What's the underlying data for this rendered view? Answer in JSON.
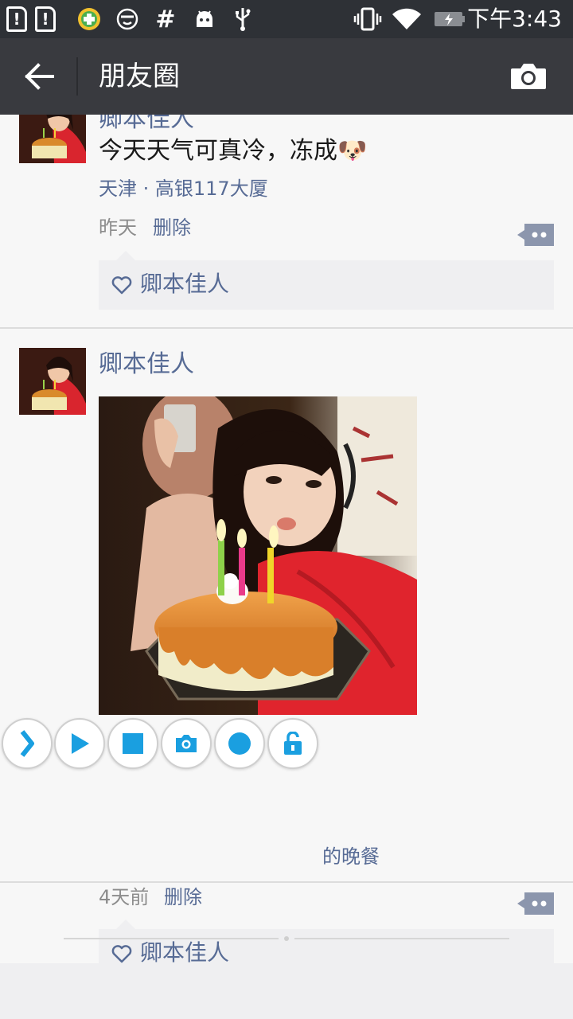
{
  "status_bar": {
    "time": "下午3:43",
    "icons": [
      "sim-alert-icon",
      "sim-alert-icon",
      "security-app-icon",
      "face-icon",
      "hash-icon",
      "android-debug-icon",
      "usb-icon",
      "vibrate-icon",
      "wifi-icon",
      "battery-charging-icon"
    ]
  },
  "header": {
    "title": "朋友圈",
    "back_icon": "arrow-left-icon",
    "camera_icon": "camera-icon"
  },
  "posts": [
    {
      "author": "卿本佳人",
      "text": "今天天气可真冷，冻成🐶",
      "location": "天津 · 高银117大厦",
      "time": "昨天",
      "delete_label": "删除",
      "likes": [
        "卿本佳人"
      ]
    },
    {
      "author": "卿本佳人",
      "caption_visible": "的晚餐",
      "time": "4天前",
      "delete_label": "删除",
      "likes": [
        "卿本佳人"
      ]
    }
  ],
  "floating_toolbar": {
    "buttons": [
      "expand-icon",
      "play-icon",
      "stop-icon",
      "screenshot-icon",
      "record-icon",
      "unlock-icon"
    ]
  },
  "colors": {
    "statusbar": "#2e3136",
    "titlebar": "#393a3f",
    "link": "#576b95",
    "toolbar_accent": "#1a9fe0"
  }
}
